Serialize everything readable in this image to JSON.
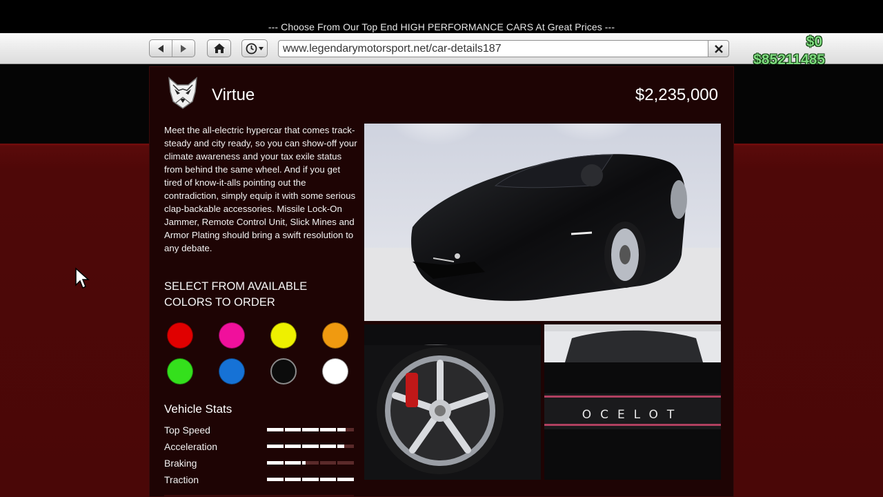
{
  "browser": {
    "tagline": "--- Choose From Our Top End HIGH PERFORMANCE CARS At Great Prices ---",
    "url": "www.legendarymotorsport.net/car-details187",
    "back_icon": "back-arrow-icon",
    "forward_icon": "forward-arrow-icon",
    "home_icon": "home-icon",
    "history_icon": "clock-icon",
    "close_icon": "close-icon"
  },
  "hud": {
    "cash": "$0",
    "bank": "$85211485",
    "color": "#7fd97f"
  },
  "vehicle": {
    "name": "Virtue",
    "price": "$2,235,000",
    "brand_logo_icon": "ocelot-cat-logo-icon",
    "description": "Meet the all-electric hypercar that comes track-steady and city ready, so you can show-off your climate awareness and your tax exile status from behind the same wheel. And if you get tired of know-it-alls pointing out the contradiction, simply equip it with some serious clap-backable accessories. Missile Lock-On Jammer, Remote Control Unit, Slick Mines and Armor Plating should bring a swift resolution to any debate.",
    "badge_text": "OCELOT"
  },
  "colors": {
    "heading": "SELECT FROM AVAILABLE COLORS TO ORDER",
    "options": [
      "#e00000",
      "#f0109c",
      "#eef000",
      "#f09a10",
      "#34e01c",
      "#1672d6",
      "#0c0c0c",
      "#ffffff"
    ]
  },
  "stats": {
    "title": "Vehicle Stats",
    "items": [
      {
        "label": "Top Speed",
        "value": 0.9
      },
      {
        "label": "Acceleration",
        "value": 0.88
      },
      {
        "label": "Braking",
        "value": 0.44
      },
      {
        "label": "Traction",
        "value": 1.0
      }
    ]
  },
  "theme": {
    "panel_bg": "#1e0404",
    "page_red": "#4e0808"
  }
}
